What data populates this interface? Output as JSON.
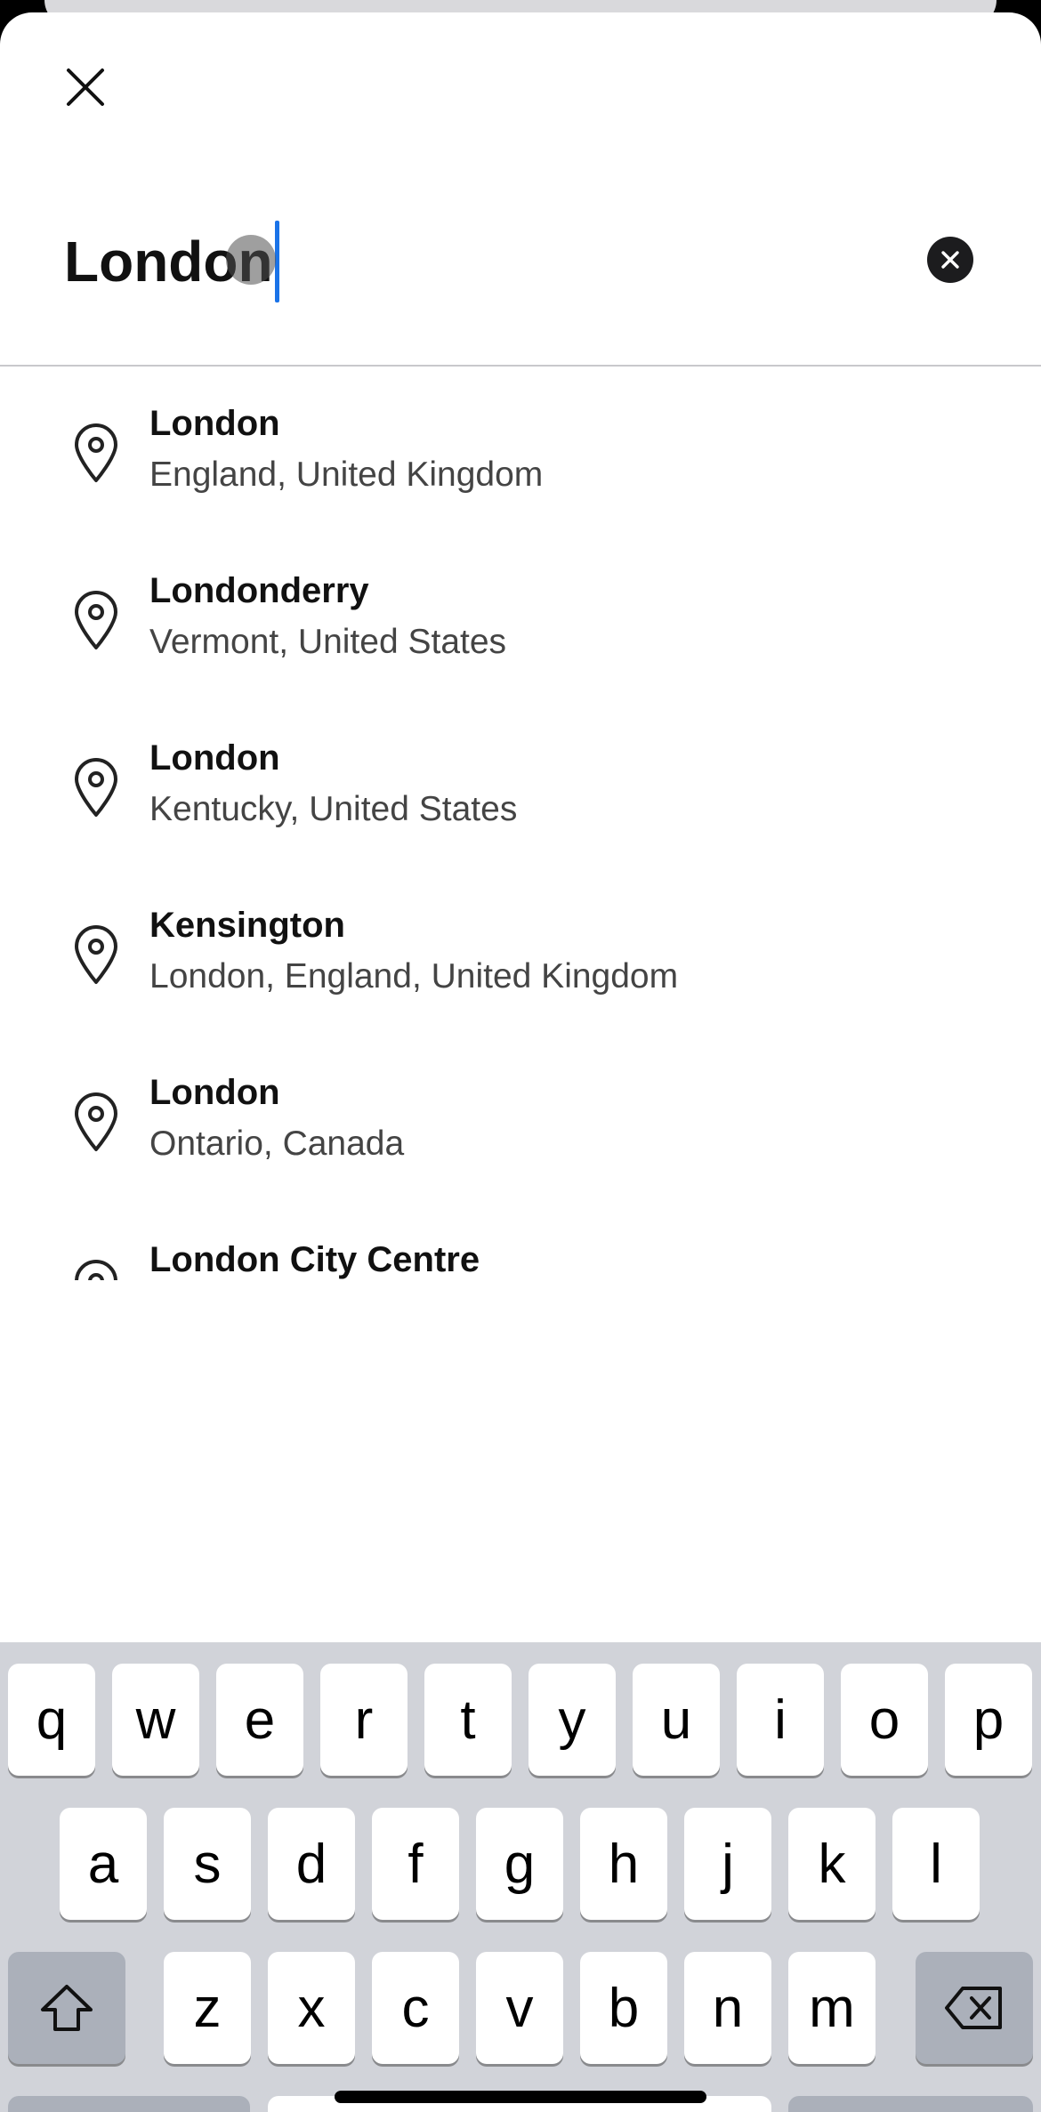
{
  "search": {
    "value": "London"
  },
  "icons": {
    "close": "close-icon",
    "clear": "clear-x-icon",
    "result": "map-pin-icon",
    "shift": "shift-arrow-icon",
    "backspace": "backspace-icon"
  },
  "results": [
    {
      "title": "London",
      "subtitle": "England, United Kingdom"
    },
    {
      "title": "Londonderry",
      "subtitle": "Vermont, United States"
    },
    {
      "title": "London",
      "subtitle": "Kentucky, United States"
    },
    {
      "title": "Kensington",
      "subtitle": "London, England, United Kingdom"
    },
    {
      "title": "London",
      "subtitle": "Ontario, Canada"
    },
    {
      "title": "London City Centre",
      "subtitle": ""
    }
  ],
  "keyboard": {
    "row1": [
      "q",
      "w",
      "e",
      "r",
      "t",
      "y",
      "u",
      "i",
      "o",
      "p"
    ],
    "row2": [
      "a",
      "s",
      "d",
      "f",
      "g",
      "h",
      "j",
      "k",
      "l"
    ],
    "row3": [
      "z",
      "x",
      "c",
      "v",
      "b",
      "n",
      "m"
    ]
  },
  "colors": {
    "caret": "#1a73e8",
    "keyboard_bg": "#d1d3d9",
    "function_key": "#abb0ba"
  }
}
